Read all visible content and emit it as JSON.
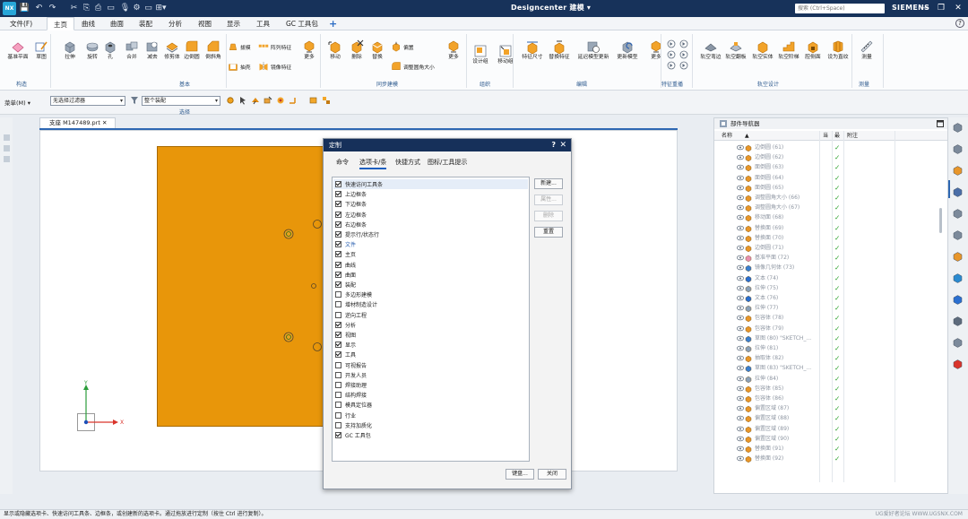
{
  "app": {
    "title": "Designcenter  建模 ▾",
    "logo_text": "NX",
    "brand": "SIEMENS",
    "search_placeholder": "搜索 (Ctrl+Space)",
    "quick_access": [
      "💾",
      "↶",
      "↷",
      "✂",
      "⎘",
      "⎙",
      "▭",
      "🎙",
      "⚙",
      "▭",
      "⊞▾"
    ],
    "window_buttons": [
      "—",
      "❐",
      "✕"
    ],
    "accent_color": "#17325a",
    "part_color": "#e8960a"
  },
  "menu_tabs": [
    {
      "label": "文件(F)"
    },
    {
      "label": "主页"
    },
    {
      "label": "曲线"
    },
    {
      "label": "曲面"
    },
    {
      "label": "装配"
    },
    {
      "label": "分析"
    },
    {
      "label": "视图"
    },
    {
      "label": "显示"
    },
    {
      "label": "工具"
    },
    {
      "label": "GC 工具包"
    }
  ],
  "plus_label": "+",
  "help_label": "?",
  "ribbon": {
    "groups": [
      {
        "label": "构造"
      },
      {
        "label": "基本"
      },
      {
        "label": "同步建模"
      },
      {
        "label": "组织"
      },
      {
        "label": "编辑"
      },
      {
        "label": "特征重播"
      },
      {
        "label": "轨空设计"
      },
      {
        "label": "测量"
      }
    ],
    "buttons": [
      {
        "label": "基准平面",
        "icon": "datum-plane-icon"
      },
      {
        "label": "草图",
        "icon": "sketch-icon"
      },
      {
        "label": "拉伸",
        "icon": "extrude-icon"
      },
      {
        "label": "旋转",
        "icon": "revolve-icon"
      },
      {
        "label": "孔",
        "icon": "hole-icon"
      },
      {
        "label": "合并",
        "icon": "unite-icon"
      },
      {
        "label": "减去",
        "icon": "subtract-icon"
      },
      {
        "label": "修剪体",
        "icon": "trim-body-icon"
      },
      {
        "label": "边倒圆",
        "icon": "edge-blend-icon"
      },
      {
        "label": "倒斜角",
        "icon": "chamfer-icon"
      },
      {
        "label": "更多",
        "icon": "more-icon"
      },
      {
        "label": "移动",
        "icon": "move-face-icon"
      },
      {
        "label": "删除",
        "icon": "delete-face-icon"
      },
      {
        "label": "替换",
        "icon": "replace-face-icon"
      },
      {
        "label": "更多",
        "icon": "more-icon"
      },
      {
        "label": "设计组",
        "icon": "design-group-icon"
      },
      {
        "label": "移动组",
        "icon": "move-group-icon"
      },
      {
        "label": "特征尺寸",
        "icon": "feature-dimension-icon"
      },
      {
        "label": "替换特征",
        "icon": "replace-feature-icon"
      },
      {
        "label": "延迟模型更新",
        "icon": "delay-update-icon"
      },
      {
        "label": "更新模型",
        "icon": "update-model-icon"
      },
      {
        "label": "更多",
        "icon": "more-icon"
      },
      {
        "label": "轨空弯边",
        "icon": "flange-icon"
      },
      {
        "label": "轨空翻板",
        "icon": "tab-icon"
      },
      {
        "label": "轨空实体",
        "icon": "solid-icon"
      },
      {
        "label": "轨空阶梯",
        "icon": "step-icon"
      },
      {
        "label": "腔侧面",
        "icon": "cavity-face-icon"
      },
      {
        "label": "设为直纹",
        "icon": "ruled-icon"
      },
      {
        "label": "测量",
        "icon": "measure-icon"
      }
    ],
    "small": [
      {
        "label": "拔模",
        "icon": "draft-icon"
      },
      {
        "label": "阵列特征",
        "icon": "pattern-feature-icon"
      },
      {
        "label": "抽壳",
        "icon": "shell-icon"
      },
      {
        "label": "镜像特征",
        "icon": "mirror-feature-icon"
      },
      {
        "label": "偏置",
        "icon": "offset-icon"
      },
      {
        "label": "调整圆角大小",
        "icon": "resize-blend-icon"
      }
    ]
  },
  "selection_bar": {
    "menu_label": "菜单(M) ▾",
    "filter_value": "无选择过滤器",
    "scope_value": "整个装配",
    "group_label": "选择"
  },
  "document": {
    "tab_label": "支座 M147489.prt ✕"
  },
  "dialog": {
    "title": "定制",
    "help_label": "?",
    "close_label": "✕",
    "tabs": [
      {
        "label": "命令"
      },
      {
        "label": "选项卡/条"
      },
      {
        "label": "快捷方式"
      },
      {
        "label": "图标/工具提示"
      }
    ],
    "items": [
      {
        "label": "快速访问工具条",
        "checked": true
      },
      {
        "label": "上边框条",
        "checked": true
      },
      {
        "label": "下边框条",
        "checked": true
      },
      {
        "label": "左边框条",
        "checked": true
      },
      {
        "label": "右边框条",
        "checked": true
      },
      {
        "label": "提示行/状态行",
        "checked": true
      },
      {
        "label": "文件",
        "checked": true
      },
      {
        "label": "主页",
        "checked": true
      },
      {
        "label": "曲线",
        "checked": true
      },
      {
        "label": "曲面",
        "checked": true
      },
      {
        "label": "装配",
        "checked": true
      },
      {
        "label": "多边形建模",
        "checked": false
      },
      {
        "label": "增材制造设计",
        "checked": false
      },
      {
        "label": "逆向工程",
        "checked": false
      },
      {
        "label": "分析",
        "checked": true
      },
      {
        "label": "视图",
        "checked": true
      },
      {
        "label": "显示",
        "checked": true
      },
      {
        "label": "工具",
        "checked": true
      },
      {
        "label": "可视报告",
        "checked": false
      },
      {
        "label": "开发人员",
        "checked": false
      },
      {
        "label": "焊接助理",
        "checked": false
      },
      {
        "label": "结构焊接",
        "checked": false
      },
      {
        "label": "模具定位器",
        "checked": false
      },
      {
        "label": "行业",
        "checked": false
      },
      {
        "label": "支持加质化",
        "checked": false
      },
      {
        "label": "GC 工具包",
        "checked": true
      }
    ],
    "buttons": {
      "new": "新建...",
      "properties": "属性...",
      "delete": "删除",
      "reset": "重置",
      "keyboard": "键盘...",
      "close": "关闭"
    }
  },
  "navigator": {
    "title": "部件导航器",
    "columns": {
      "name": "名称",
      "sort": "▲",
      "current": "当",
      "latest": "最",
      "note": "附注"
    },
    "rows": [
      {
        "label": "边倒圆 (61)",
        "icon": "blend"
      },
      {
        "label": "边倒圆 (62)",
        "icon": "blend"
      },
      {
        "label": "面倒圆 (63)",
        "icon": "blend"
      },
      {
        "label": "面倒圆 (64)",
        "icon": "blend"
      },
      {
        "label": "面倒圆 (65)",
        "icon": "blend"
      },
      {
        "label": "调整圆角大小 (66)",
        "icon": "blend"
      },
      {
        "label": "调整圆角大小 (67)",
        "icon": "blend"
      },
      {
        "label": "移动面 (68)",
        "icon": "face"
      },
      {
        "label": "替换面 (69)",
        "icon": "face"
      },
      {
        "label": "替换面 (70)",
        "icon": "face"
      },
      {
        "label": "边倒圆 (71)",
        "icon": "blend"
      },
      {
        "label": "基准平面 (72)",
        "icon": "plane"
      },
      {
        "label": "镜像几何体 (73)",
        "icon": "mirror"
      },
      {
        "label": "文本 (74)",
        "icon": "text"
      },
      {
        "label": "拉伸 (75)",
        "icon": "extrude"
      },
      {
        "label": "文本 (76)",
        "icon": "text"
      },
      {
        "label": "拉伸 (77)",
        "icon": "extrude"
      },
      {
        "label": "包容体 (78)",
        "icon": "box"
      },
      {
        "label": "包容体 (79)",
        "icon": "box"
      },
      {
        "label": "草图 (80) \"SKETCH_...",
        "icon": "sketch"
      },
      {
        "label": "拉伸 (81)",
        "icon": "extrude"
      },
      {
        "label": "抽取体 (82)",
        "icon": "extract"
      },
      {
        "label": "草图 (83) \"SKETCH_...",
        "icon": "sketch"
      },
      {
        "label": "拉伸 (84)",
        "icon": "extrude"
      },
      {
        "label": "包容体 (85)",
        "icon": "box"
      },
      {
        "label": "包容体 (86)",
        "icon": "box"
      },
      {
        "label": "偏置区域 (87)",
        "icon": "face"
      },
      {
        "label": "偏置区域 (88)",
        "icon": "face"
      },
      {
        "label": "偏置区域 (89)",
        "icon": "face"
      },
      {
        "label": "偏置区域 (90)",
        "icon": "face"
      },
      {
        "label": "替换面 (91)",
        "icon": "face"
      },
      {
        "label": "替换面 (92)",
        "icon": "face"
      }
    ],
    "check_mark": "✓"
  },
  "status": {
    "text": "显示或隐藏选项卡、快速访问工具条、边框条，或创建新的选项卡。通过拖放进行定制（按住 Ctrl 进行复制）。",
    "watermark": "UG爱好者论坛 WWW.UGSNX.COM"
  }
}
